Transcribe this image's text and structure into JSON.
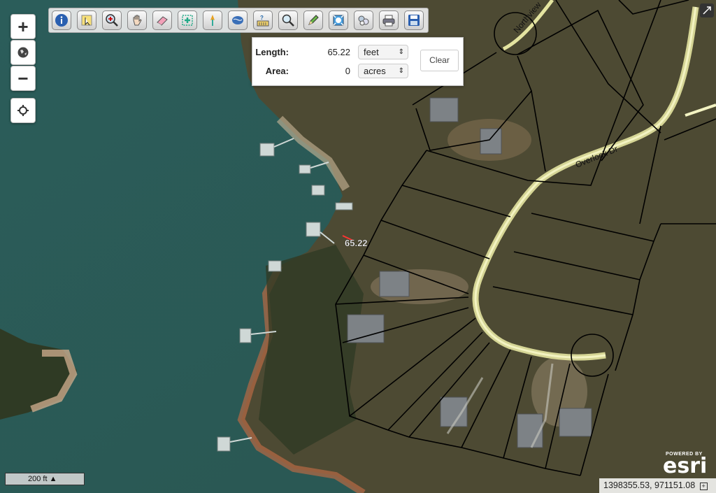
{
  "map": {
    "measure_label": "65.22",
    "roads": [
      "Northview",
      "Overlook Dr"
    ]
  },
  "zoom": {
    "zoom_in": "+",
    "zoom_out": "−"
  },
  "toolbar": {
    "tools": [
      "info-icon",
      "select-icon",
      "zoom-in-icon",
      "pan-hand-icon",
      "eraser-icon",
      "select-parcels-icon",
      "pin-icon",
      "basemap-icon",
      "query-icon",
      "search-icon",
      "draw-pencil-icon",
      "full-extent-icon",
      "layers-icon",
      "print-icon",
      "save-icon"
    ]
  },
  "measure": {
    "length_label": "Length:",
    "length_value": "65.22",
    "length_unit": "feet",
    "area_label": "Area:",
    "area_value": "0",
    "area_unit": "acres",
    "clear_label": "Clear"
  },
  "scalebar": {
    "label": "200 ft ▲"
  },
  "attribution": {
    "powered_by": "POWERED BY",
    "brand": "esri"
  },
  "coordinates": {
    "text": "1398355.53, 971151.08"
  }
}
